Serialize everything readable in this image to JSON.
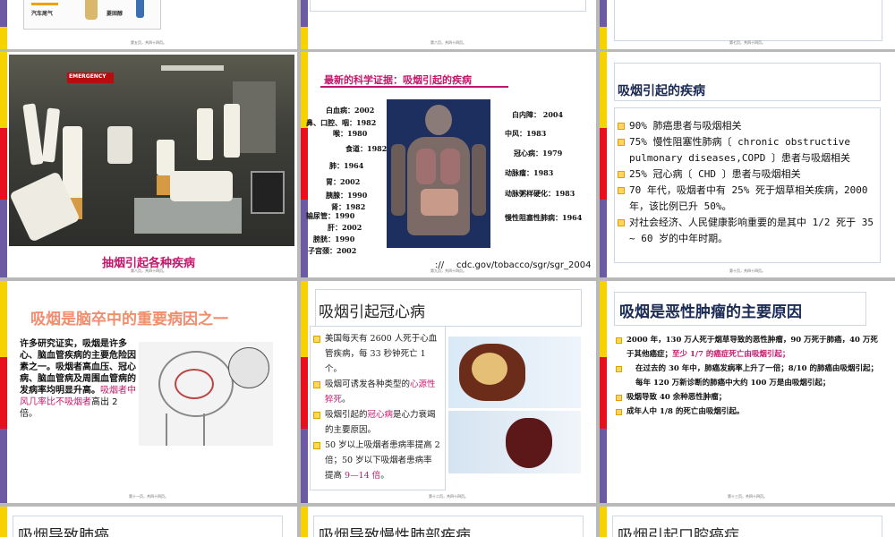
{
  "row1": {
    "s1": {
      "label_left": "汽车尾气",
      "label_right": "菱固醇",
      "page": "第五页，共四十四页。"
    },
    "s2": {
      "page": "第六页，共四十四页。"
    },
    "s3": {
      "page": "第七页，共四十四页。"
    }
  },
  "s4": {
    "caption": "抽烟引起各种疾病",
    "sign": "EMERGENCY",
    "page": "第八页，共四十四页。"
  },
  "s5": {
    "title": "最新的科学证据：吸烟引起的疾病",
    "left_labels": [
      "白血病：2002",
      "鼻、口腔、咽：1982",
      "喉：1980",
      "食道：1982",
      "肺：1964",
      "胃：2002",
      "胰腺：1990",
      "肾：1982",
      "输尿管：1990",
      "肝：2002",
      "膀胱：1990",
      "子宫颈：2002"
    ],
    "right_labels": [
      "白内障： 2004",
      "中风：1983",
      "冠心病：1979",
      "动脉瘤：1983",
      "动脉粥样硬化：1983",
      "慢性阻塞性肺病：1964"
    ],
    "url": "cdc.gov/tobacco/sgr/sgr_2004",
    "url_prefix": "://",
    "page": "第九页，共四十四页。"
  },
  "s6": {
    "title": "吸烟引起的疾病",
    "bullets": [
      "90% 肺癌患者与吸烟相关",
      "75% 慢性阻塞性肺病〔 chronic obstructive pulmonary diseases,COPD 〕患者与吸烟相关",
      "25% 冠心病〔 CHD 〕患者与吸烟相关",
      "70 年代，吸烟者中有 25% 死于烟草相关疾病，2000 年，该比例已升 50%。",
      "对社会经济、人民健康影响重要的是其中 1/2 死于 35 ~ 60 岁的中年时期。"
    ],
    "page": "第十页，共四十四页。"
  },
  "s7": {
    "title": "吸烟是脑卒中的重要病因之一",
    "body": "许多研究证实，吸烟是许多心、脑血管疾病的主要危险因素之一。吸烟者高血压、冠心病、脑血管病及周围血管病的发病率均明显升高。",
    "hl_text": "吸烟者中风几率比不吸烟者",
    "tail_text": "高出 2 倍。",
    "page": "第十一页，共四十四页。"
  },
  "s8": {
    "title": "吸烟引起冠心病",
    "b1a": "美国每天有 2600 人死于心血管疾病，每 33 秒钟死亡 1 个。",
    "b2a": "吸烟可诱发各种类型的",
    "b2h": "心源性猝死",
    "b2b": "。",
    "b3a": "吸烟引起的",
    "b3h": "冠心病",
    "b3b": "是心力衰竭的主要原因。",
    "b4a": "50 岁以上吸烟者患病率提高 2 倍；50 岁以下吸烟者患病率提高 ",
    "b4h": "9—14 倍",
    "b4b": "。",
    "page": "第十二页，共四十四页。"
  },
  "s9": {
    "title": "吸烟是恶性肿瘤的主要原因",
    "b1": "2000 年，130 万人死于烟草导致的恶性肿瘤，90 万死于肺癌，40 万死于其他癌症；",
    "b1h": "至少 1/7 的癌症死亡由吸烟引起；",
    "b2": "在过去的 30 年中，肺癌发病率上升了一倍；8/10 的肺癌由吸烟引起；每年 120 万新诊断的肺癌中大约 100 万是由吸烟引起；",
    "b3": "吸烟导致 40 余种恶性肿瘤；",
    "b4": "成年人中 1/8 的死亡由吸烟引起。",
    "page": "第十三页，共四十四页。"
  },
  "row4": {
    "t1": "吸烟导致肺癌",
    "t2": "吸烟导致慢性肺部疾病",
    "t3": "吸烟引起口腔癌症"
  },
  "colors": {
    "accent_red": "#e8101c",
    "accent_yellow": "#f6d200",
    "accent_purple": "#6c5aa3",
    "accent_magenta": "#c2186b",
    "bg": "#b9b9b9"
  }
}
